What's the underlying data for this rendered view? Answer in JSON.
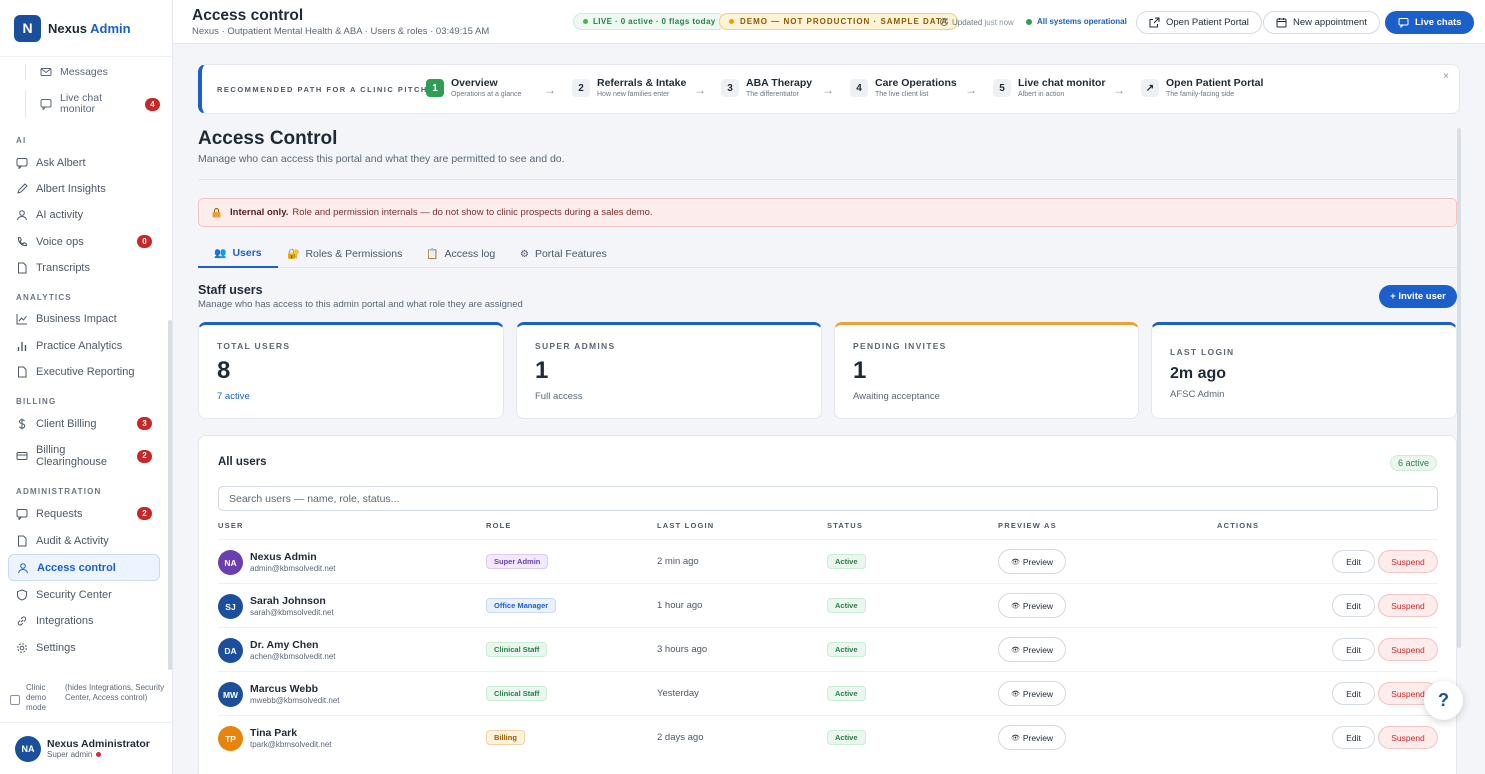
{
  "brand": {
    "logo": "N",
    "name": "Nexus",
    "accent": "Admin"
  },
  "sidebar": {
    "sub_items": [
      {
        "label": "Messages",
        "icon": "envelope-icon"
      },
      {
        "label": "Live chat monitor",
        "icon": "chat-icon",
        "badge": "4"
      }
    ],
    "sections": {
      "ai": "AI",
      "analytics": "ANALYTICS",
      "billing": "BILLING",
      "administration": "ADMINISTRATION"
    },
    "ai_items": [
      {
        "label": "Ask Albert",
        "icon": "chat-icon"
      },
      {
        "label": "Albert Insights",
        "icon": "pen-icon"
      },
      {
        "label": "AI activity",
        "icon": "person-icon"
      },
      {
        "label": "Voice ops",
        "icon": "phone-icon",
        "badge": "0"
      },
      {
        "label": "Transcripts",
        "icon": "document-icon"
      }
    ],
    "analytics_items": [
      {
        "label": "Business Impact",
        "icon": "trend-icon"
      },
      {
        "label": "Practice Analytics",
        "icon": "bar-chart-icon"
      },
      {
        "label": "Executive Reporting",
        "icon": "document-icon"
      }
    ],
    "billing_items": [
      {
        "label": "Client Billing",
        "icon": "dollar-icon",
        "badge": "3"
      },
      {
        "label": "Billing Clearinghouse",
        "icon": "card-icon",
        "badge": "2"
      }
    ],
    "admin_items": [
      {
        "label": "Requests",
        "icon": "chat-icon",
        "badge": "2"
      },
      {
        "label": "Audit & Activity",
        "icon": "document-icon"
      },
      {
        "label": "Access control",
        "icon": "person-icon",
        "active": true
      },
      {
        "label": "Security Center",
        "icon": "shield-icon"
      },
      {
        "label": "Integrations",
        "icon": "link-icon"
      },
      {
        "label": "Settings",
        "icon": "gear-icon"
      }
    ],
    "demo_toggle": {
      "label": "Clinic demo mode",
      "hint": "(hides Integrations, Security Center, Access control)"
    },
    "user": {
      "initials": "NA",
      "name": "Nexus Administrator",
      "role": "Super admin"
    }
  },
  "topbar": {
    "title": "Access control",
    "breadcrumb": "Nexus · Outpatient Mental Health & ABA · Users & roles · 03:49:15 AM",
    "live_pill": "LIVE · 0 active · 0 flags today",
    "demo_pill": "DEMO — NOT PRODUCTION · SAMPLE DATA",
    "updated": "Updated",
    "updated_when": "just now",
    "ops_status": "All systems operational",
    "open_portal": "Open Patient Portal",
    "new_appointment": "New appointment",
    "live_chats": "Live chats"
  },
  "pitch_path": {
    "label": "RECOMMENDED PATH FOR A CLINIC PITCH",
    "close": "×",
    "steps": [
      {
        "num": "1",
        "title": "Overview",
        "sub": "Operations at a glance"
      },
      {
        "num": "2",
        "title": "Referrals & Intake",
        "sub": "How new families enter"
      },
      {
        "num": "3",
        "title": "ABA Therapy",
        "sub": "The differentiator"
      },
      {
        "num": "4",
        "title": "Care Operations",
        "sub": "The live client list"
      },
      {
        "num": "5",
        "title": "Live chat monitor",
        "sub": "Albert in action"
      },
      {
        "num": "↗",
        "title": "Open Patient Portal",
        "sub": "The family-facing side"
      }
    ],
    "arrow": "→"
  },
  "page": {
    "title": "Access Control",
    "subtitle": "Manage who can access this portal and what they are permitted to see and do.",
    "warning_bold": "Internal only.",
    "warning_text": "Role and permission internals — do not show to clinic prospects during a sales demo."
  },
  "tabs": [
    {
      "icon": "👥",
      "label": "Users",
      "active": true
    },
    {
      "icon": "🔐",
      "label": "Roles & Permissions"
    },
    {
      "icon": "📋",
      "label": "Access log"
    },
    {
      "icon": "⚙",
      "label": "Portal Features"
    }
  ],
  "staff": {
    "title": "Staff users",
    "subtitle": "Manage who has access to this admin portal and what role they are assigned",
    "invite": "+ Invite user"
  },
  "stats": [
    {
      "label": "TOTAL USERS",
      "value": "8",
      "foot": "7 active"
    },
    {
      "label": "SUPER ADMINS",
      "value": "1",
      "foot": "Full access"
    },
    {
      "label": "PENDING INVITES",
      "value": "1",
      "foot": "Awaiting acceptance"
    },
    {
      "label": "LAST LOGIN",
      "value": "2m ago",
      "foot": "AFSC Admin"
    }
  ],
  "users_table": {
    "title": "All users",
    "badge": "6 active",
    "search_placeholder": "Search users — name, role, status...",
    "columns": [
      "USER",
      "ROLE",
      "LAST LOGIN",
      "STATUS",
      "PREVIEW AS",
      "ACTIONS"
    ],
    "preview_label": "Preview",
    "eye": "👁",
    "edit_label": "Edit",
    "suspend_label": "Suspend",
    "rows": [
      {
        "initials": "NA",
        "name": "Nexus Admin",
        "email": "admin@kbmsolvedit.net",
        "role": "Super Admin",
        "last_login": "2 min ago",
        "status": "Active"
      },
      {
        "initials": "SJ",
        "name": "Sarah Johnson",
        "email": "sarah@kbmsolvedit.net",
        "role": "Office Manager",
        "last_login": "1 hour ago",
        "status": "Active"
      },
      {
        "initials": "DA",
        "name": "Dr. Amy Chen",
        "email": "achen@kbmsolvedit.net",
        "role": "Clinical Staff",
        "last_login": "3 hours ago",
        "status": "Active"
      },
      {
        "initials": "MW",
        "name": "Marcus Webb",
        "email": "mwebb@kbmsolvedit.net",
        "role": "Clinical Staff",
        "last_login": "Yesterday",
        "status": "Active"
      },
      {
        "initials": "TP",
        "name": "Tina Park",
        "email": "tpark@kbmsolvedit.net",
        "role": "Billing",
        "last_login": "2 days ago",
        "status": "Active"
      }
    ]
  },
  "help": "?",
  "colors": {
    "primary": "#1b5fc8",
    "brand": "#1b4f9c",
    "success": "#2e9e52",
    "danger": "#c62828",
    "warning": "#e8a23a"
  }
}
